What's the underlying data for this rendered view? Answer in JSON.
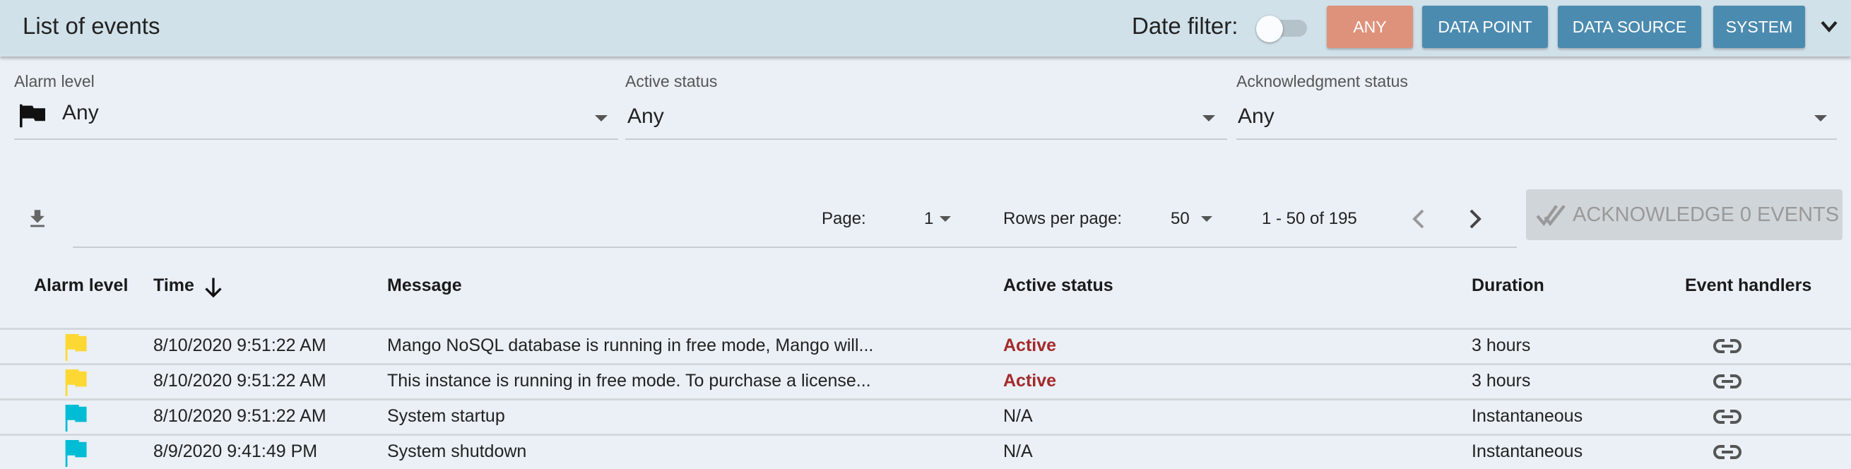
{
  "header": {
    "title": "List of events",
    "date_filter_label": "Date filter:",
    "date_filter_on": false,
    "buttons": [
      {
        "label": "ANY",
        "color": "#de927b"
      },
      {
        "label": "DATA POINT",
        "color": "#4c8bb0"
      },
      {
        "label": "DATA SOURCE",
        "color": "#4c8bb0"
      },
      {
        "label": "SYSTEM",
        "color": "#4c8bb0"
      }
    ]
  },
  "filters": {
    "alarm_level": {
      "label": "Alarm level",
      "value": "Any"
    },
    "active_status": {
      "label": "Active status",
      "value": "Any"
    },
    "ack_status": {
      "label": "Acknowledgment status",
      "value": "Any"
    }
  },
  "pagination": {
    "page_label": "Page:",
    "page": "1",
    "rows_label": "Rows per page:",
    "rows": "50",
    "range": "1 - 50 of 195"
  },
  "ack_button": "ACKNOWLEDGE 0 EVENTS",
  "table": {
    "columns": [
      "Alarm level",
      "Time",
      "Message",
      "Active status",
      "Duration",
      "Event handlers"
    ],
    "rows": [
      {
        "level_color": "#fdd835",
        "time": "8/10/2020 9:51:22 AM",
        "message": "Mango NoSQL database is running in free mode, Mango will...",
        "status": "Active",
        "duration": "3 hours"
      },
      {
        "level_color": "#fdd835",
        "time": "8/10/2020 9:51:22 AM",
        "message": "This instance is running in free mode. To purchase a license...",
        "status": "Active",
        "duration": "3 hours"
      },
      {
        "level_color": "#00bcd4",
        "time": "8/10/2020 9:51:22 AM",
        "message": "System startup",
        "status": "N/A",
        "duration": "Instantaneous"
      },
      {
        "level_color": "#00bcd4",
        "time": "8/9/2020 9:41:49 PM",
        "message": "System shutdown",
        "status": "N/A",
        "duration": "Instantaneous"
      }
    ]
  }
}
